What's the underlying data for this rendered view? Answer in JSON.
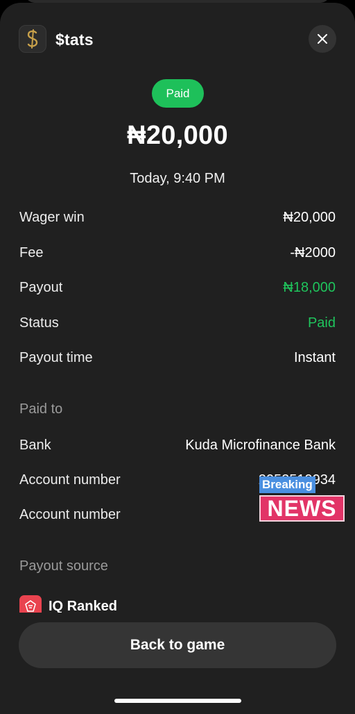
{
  "header": {
    "app_name": "$tats",
    "app_icon": "dollar-logo-icon",
    "close_icon": "close-icon"
  },
  "transaction": {
    "status_pill": "Paid",
    "amount": "₦20,000",
    "datetime": "Today, 9:40 PM"
  },
  "details": [
    {
      "label": "Wager win",
      "value": "₦20,000"
    },
    {
      "label": "Fee",
      "value": "-₦2000"
    },
    {
      "label": "Payout",
      "value": "₦18,000"
    },
    {
      "label": "Status",
      "value": "Paid"
    },
    {
      "label": "Payout time",
      "value": "Instant"
    }
  ],
  "paid_to": {
    "title": "Paid to",
    "rows": [
      {
        "label": "Bank",
        "value": "Kuda Microfinance Bank"
      },
      {
        "label": "Account number",
        "value": "2052519934"
      },
      {
        "label": "Account number",
        "value": ""
      }
    ]
  },
  "payout_source": {
    "title": "Payout source",
    "name": "IQ Ranked",
    "icon": "iq-ranked-icon"
  },
  "overlay": {
    "breaking": "Breaking",
    "news": "NEWS"
  },
  "actions": {
    "back_button": "Back to game"
  },
  "colors": {
    "accent_green": "#1fc45c",
    "background": "#202020",
    "button": "#353535"
  }
}
